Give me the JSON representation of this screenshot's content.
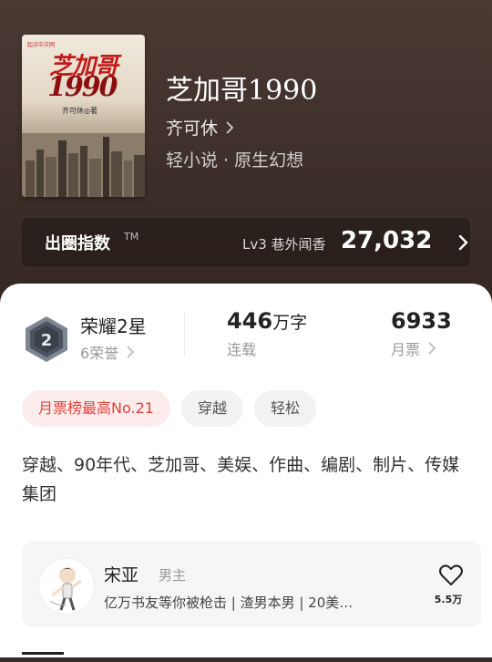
{
  "book": {
    "title": "芝加哥1990",
    "author": "齐可休",
    "genre": "轻小说 · 原生幻想",
    "cover": {
      "publisher_tag": "起点中文网",
      "title_line1": "芝加哥",
      "title_line2": "1990",
      "author_mark": "齐可休◎著"
    }
  },
  "influence": {
    "label": "出圈指数",
    "trademark": "TM",
    "level": "Lv3 巷外闻香",
    "score": "27,032"
  },
  "honor": {
    "title": "荣耀2星",
    "subtitle": "6荣誉",
    "badge_number": "2"
  },
  "stats": {
    "words_value": "446",
    "words_unit": "万字",
    "words_label": "连载",
    "tickets_value": "6933",
    "tickets_label": "月票"
  },
  "tags": [
    "月票榜最高No.21",
    "穿越",
    "轻松"
  ],
  "description": "穿越、90年代、芝加哥、美娱、作曲、编剧、制片、传媒集团",
  "character": {
    "name": "宋亚",
    "role": "男主",
    "desc": "亿万书友等你被枪击 | 渣男本男 | 20美…",
    "likes": "5.5万"
  },
  "colors": {
    "hero_bg": "#3b2d28",
    "accent_red": "#e0413a",
    "pill_bg": "#f2f2f2"
  }
}
